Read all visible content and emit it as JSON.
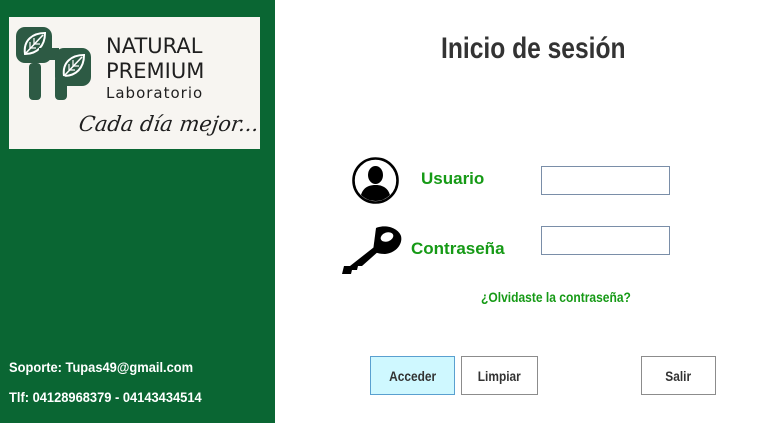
{
  "brand": {
    "line1": "NATURAL",
    "line2": "PREMIUM",
    "line3": "Laboratorio",
    "tagline": "Cada día mejor..."
  },
  "footer": {
    "support": "Soporte: Tupas49@gmail.com",
    "phone": "Tlf: 04128968379 - 04143434514"
  },
  "login": {
    "title": "Inicio de sesión",
    "user_label": "Usuario",
    "user_value": "",
    "pass_label": "Contraseña",
    "pass_value": "",
    "forgot_link": "¿Olvidaste la contraseña?"
  },
  "buttons": {
    "acceder": "Acceder",
    "limpiar": "Limpiar",
    "salir": "Salir"
  },
  "colors": {
    "panel": "#0a6633",
    "accent_text": "#169a16",
    "primary_button": "#cff8ff"
  },
  "icons": {
    "logo": "leaf-logo-icon",
    "user": "user-icon",
    "password": "key-icon"
  }
}
